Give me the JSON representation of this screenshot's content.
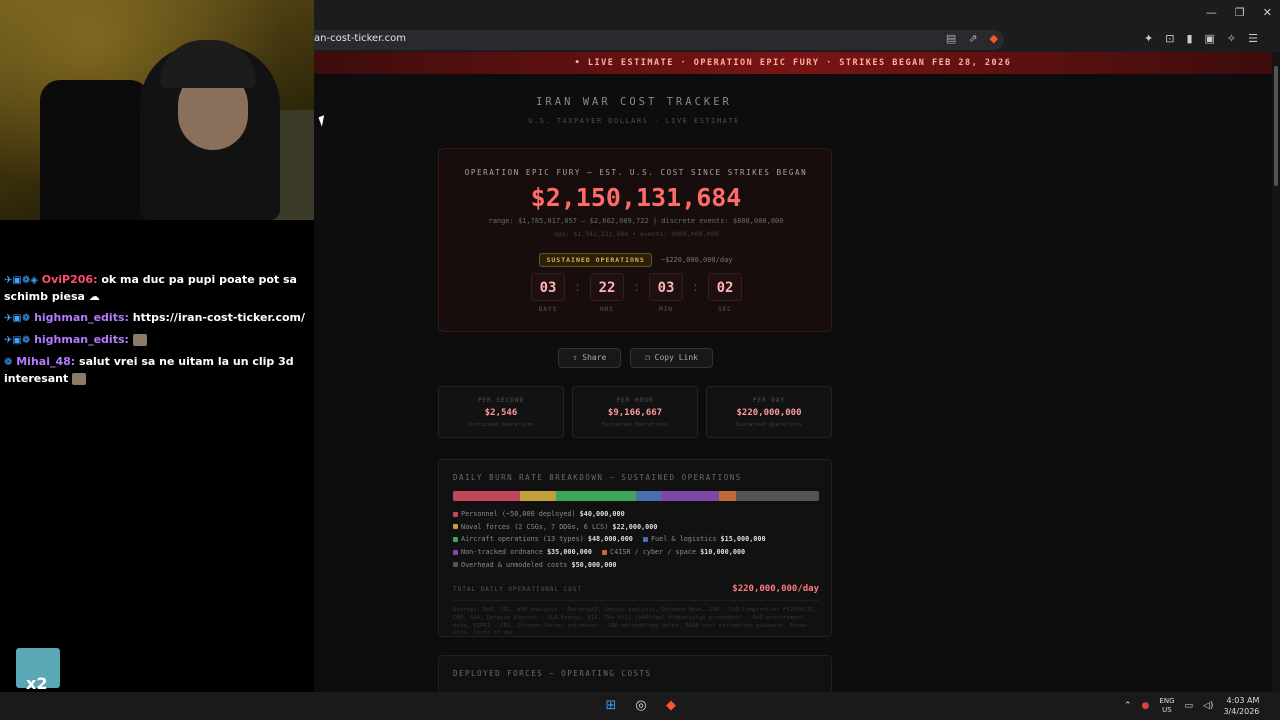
{
  "browser": {
    "url": "an-cost-ticker.com"
  },
  "banner": {
    "text": "• LIVE ESTIMATE · OPERATION EPIC FURY · STRIKES BEGAN FEB 28, 2026"
  },
  "header": {
    "title": "IRAN WAR COST TRACKER",
    "subtitle": "U.S. TAXPAYER DOLLARS · LIVE ESTIMATE"
  },
  "main": {
    "label": "OPERATION EPIC FURY — EST. U.S. COST SINCE STRIKES BEGAN",
    "amount": "$2,150,131,684",
    "range": "range: $1,785,817,057 – $2,662,009,722 | discrete events: $808,000,000",
    "ops": "ops: $1,342,131,684 • events: $808,000,000",
    "badge": "SUSTAINED OPERATIONS",
    "rate": "~$220,000,000/day",
    "countdown": [
      {
        "value": "03",
        "label": "DAYS"
      },
      {
        "value": "22",
        "label": "HRS"
      },
      {
        "value": "03",
        "label": "MIN"
      },
      {
        "value": "02",
        "label": "SEC"
      }
    ]
  },
  "actions": {
    "share": "⇪ Share",
    "copy": "❐ Copy Link"
  },
  "stats": [
    {
      "label": "PER SECOND",
      "value": "$2,546",
      "sub": "Sustained Operations"
    },
    {
      "label": "PER HOUR",
      "value": "$9,166,667",
      "sub": "Sustained Operations"
    },
    {
      "label": "PER DAY",
      "value": "$220,000,000",
      "sub": "Sustained Operations"
    }
  ],
  "breakdown": {
    "title": "DAILY BURN RATE BREAKDOWN — SUSTAINED OPERATIONS",
    "segments": [
      {
        "share": 0.182,
        "color": "#c0485a"
      },
      {
        "share": 0.1,
        "color": "#c4a03a"
      },
      {
        "share": 0.218,
        "color": "#3fa55a"
      },
      {
        "share": 0.068,
        "color": "#4a6fb0"
      },
      {
        "share": 0.159,
        "color": "#7b4aa8"
      },
      {
        "share": 0.045,
        "color": "#c46a3a"
      },
      {
        "share": 0.228,
        "color": "#555555"
      }
    ],
    "legend_rows": [
      [
        {
          "label": "Personnel (~50,000 deployed)",
          "value": "$40,000,000",
          "color": "#c0485a"
        }
      ],
      [
        {
          "label": "Naval forces (2 CSGs, 7 DDGs, 6 LCS)",
          "value": "$22,000,000",
          "color": "#c4a03a"
        }
      ],
      [
        {
          "label": "Aircraft operations (13 types)",
          "value": "$48,000,000",
          "color": "#3fa55a"
        },
        {
          "label": "Fuel & logistics",
          "value": "$15,000,000",
          "color": "#4a6fb0"
        }
      ],
      [
        {
          "label": "Non-tracked ordnance",
          "value": "$35,000,000",
          "color": "#7b4aa8"
        },
        {
          "label": "C4ISR / cyber / space",
          "value": "$10,000,000",
          "color": "#c46a3a"
        }
      ],
      [
        {
          "label": "Overhead & unmodeled costs",
          "value": "$50,000,000",
          "color": "#555555"
        }
      ]
    ],
    "total_label": "TOTAL DAILY OPERATIONAL COST",
    "total_value": "$220,000,000/day",
    "sources": "Sources: DoD, CRS, WPR analysis · DefenceXP, Senior analysis, Defense News, GAO · DoD Comptroller FY2024/25, CBO, GAO, Defense Express · OLA Energy, EIA, The Hill ($400/gal Afghanistan precedent) · DoD procurement data, SIPRI · CBS, Stimson Center estimates · CBO methodology notes, RAND cost estimation guidance, Brown Univ, Costs of War"
  },
  "forces": {
    "title": "DEPLOYED FORCES — OPERATING COSTS"
  },
  "chat": {
    "messages": [
      {
        "badges": "✈▣❁◈",
        "user": "OviP206:",
        "text": "ok ma duc pa pupi poate pot sa schimb piesa ☁"
      },
      {
        "badges": "✈▣❁",
        "user": "highman_edits:",
        "text": "https://iran-cost-ticker.com/"
      },
      {
        "badges": "✈▣❁",
        "user": "highman_edits:",
        "text": ""
      },
      {
        "badges": "❁",
        "user": "Mihai_48:",
        "text": "salut vrei sa ne uitam la un clip 3d interesant"
      }
    ],
    "corner_label": "x2"
  },
  "taskbar": {
    "lang_top": "ENG",
    "lang_bottom": "US",
    "time": "4:03 AM",
    "date": "3/4/2026"
  },
  "icons": {
    "minimize": "—",
    "restore": "❐",
    "close": "✕"
  }
}
